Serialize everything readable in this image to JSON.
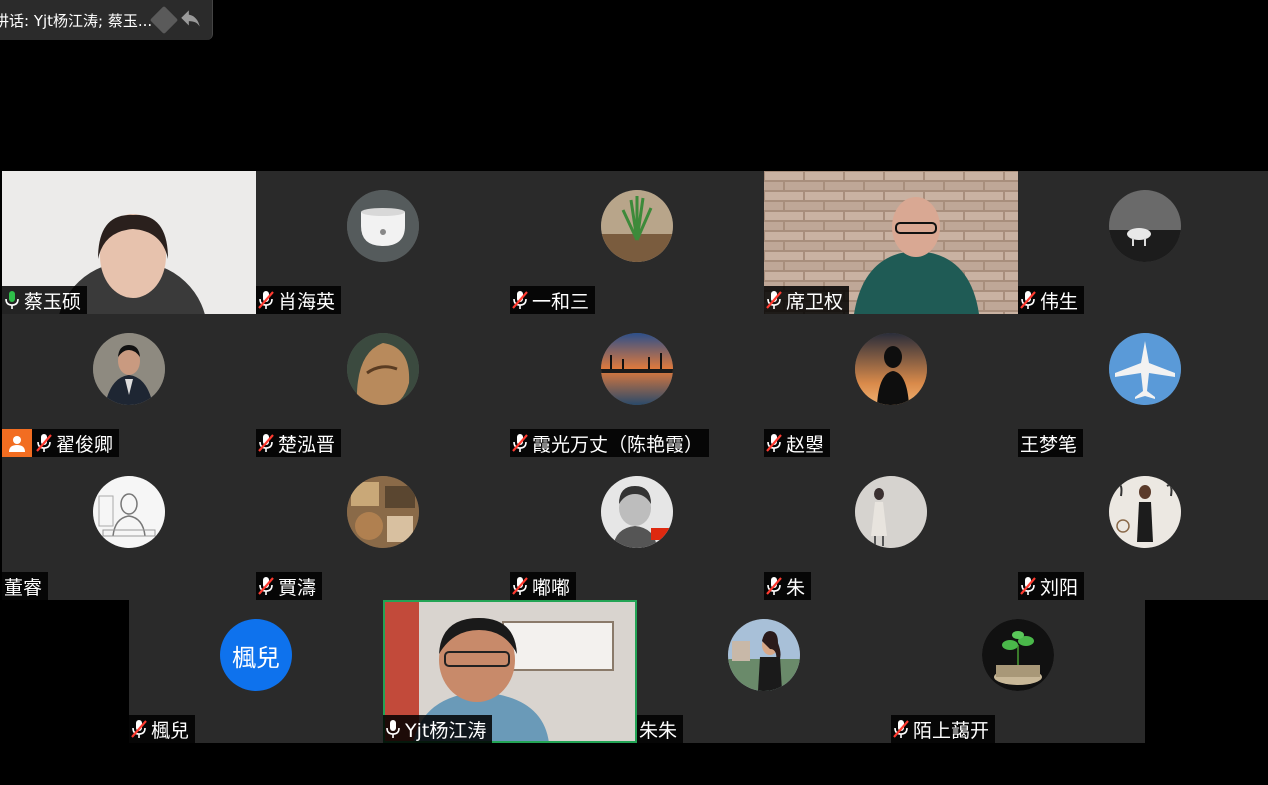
{
  "speaker_bar": {
    "text": "讲话: Yjt杨江涛; 蔡玉..."
  },
  "colors": {
    "accent": "#0e72ed",
    "active_speaker": "#23a455",
    "host_badge": "#f26d21",
    "muted_mic": "#ff3b30",
    "tile_bg": "#2a2a2a"
  },
  "participants": [
    {
      "name": "蔡玉硕",
      "mic": "on",
      "video": true
    },
    {
      "name": "肖海英",
      "mic": "muted",
      "avatar": "cup-photo"
    },
    {
      "name": "一和三",
      "mic": "muted",
      "avatar": "plant-photo"
    },
    {
      "name": "席卫权",
      "mic": "muted",
      "video": true
    },
    {
      "name": "伟生",
      "mic": "muted",
      "avatar": "horse-photo"
    },
    {
      "name": "翟俊卿",
      "mic": "muted",
      "avatar": "man-suit-photo",
      "host": true
    },
    {
      "name": "楚泓晋",
      "mic": "muted",
      "avatar": "sculpture-photo"
    },
    {
      "name": "霞光万丈（陈艳霞）",
      "mic": "muted",
      "avatar": "sunset-lake-photo"
    },
    {
      "name": "赵曌",
      "mic": "muted",
      "avatar": "silhouette-photo"
    },
    {
      "name": "王梦笔",
      "mic": "none",
      "avatar": "airplane-photo"
    },
    {
      "name": "董睿",
      "mic": "none",
      "avatar": "sketch-photo"
    },
    {
      "name": "賈濤",
      "mic": "muted",
      "avatar": "collage-photo"
    },
    {
      "name": "嘟嘟",
      "mic": "muted",
      "avatar": "child-photo"
    },
    {
      "name": "朱",
      "mic": "muted",
      "avatar": "person-photo"
    },
    {
      "name": "刘阳",
      "mic": "muted",
      "avatar": "woman-standing-photo"
    },
    {
      "name": "楓兒",
      "mic": "muted",
      "initials": "楓兒"
    },
    {
      "name": "Yjt杨江涛",
      "mic": "on",
      "video": true,
      "active": true
    },
    {
      "name": "朱朱",
      "mic": "none",
      "avatar": "woman-outdoor-photo"
    },
    {
      "name": "陌上藹开",
      "mic": "muted",
      "avatar": "plant-coins-photo"
    }
  ]
}
